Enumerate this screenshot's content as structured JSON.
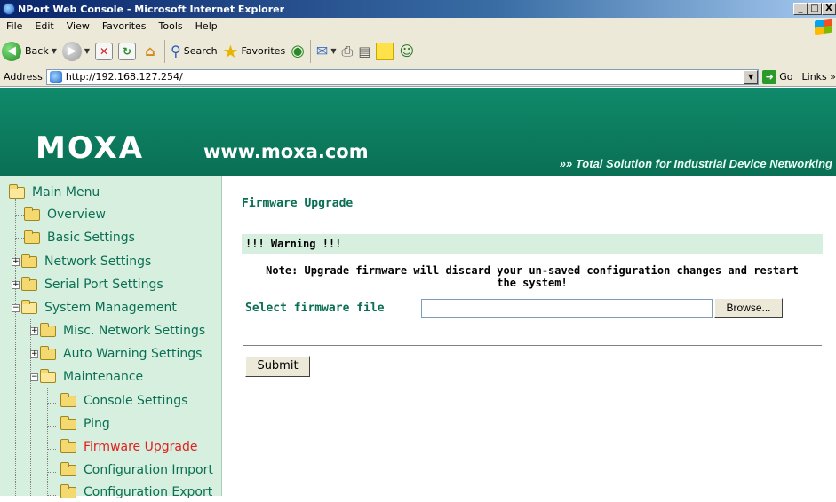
{
  "window": {
    "title": "NPort Web Console - Microsoft Internet Explorer",
    "buttons": [
      "_",
      "□",
      "X"
    ]
  },
  "menubar": [
    {
      "label": "File"
    },
    {
      "label": "Edit"
    },
    {
      "label": "View"
    },
    {
      "label": "Favorites"
    },
    {
      "label": "Tools"
    },
    {
      "label": "Help"
    }
  ],
  "toolbar": {
    "back_label": "Back",
    "search_label": "Search",
    "favorites_label": "Favorites"
  },
  "address": {
    "label": "Address",
    "url": "http://192.168.127.254/",
    "go_label": "Go",
    "links_label": "Links »"
  },
  "banner": {
    "logo": "MOXA",
    "site": "www.moxa.com",
    "tagline": "»» Total Solution for Industrial Device Networking"
  },
  "sidebar": {
    "items": [
      {
        "label": "Main Menu"
      },
      {
        "label": "Overview"
      },
      {
        "label": "Basic Settings"
      },
      {
        "label": "Network Settings"
      },
      {
        "label": "Serial Port Settings"
      },
      {
        "label": "System Management"
      },
      {
        "label": "Misc. Network Settings"
      },
      {
        "label": "Auto Warning Settings"
      },
      {
        "label": "Maintenance"
      },
      {
        "label": "Console Settings"
      },
      {
        "label": "Ping"
      },
      {
        "label": "Firmware Upgrade"
      },
      {
        "label": "Configuration Import"
      },
      {
        "label": "Configuration Export"
      }
    ],
    "active": "Firmware Upgrade"
  },
  "main": {
    "title": "Firmware Upgrade",
    "warning": "!!! Warning !!!",
    "note_line1": "Note: Upgrade firmware will discard your un-saved configuration changes and restart",
    "note_line2": "the system!",
    "file_label": "Select firmware file",
    "file_value": "",
    "browse_label": "Browse...",
    "submit_label": "Submit"
  },
  "colors": {
    "brand_green": "#0a6f55",
    "sidebar_bg": "#d7efdf",
    "active_item": "#e02020"
  },
  "icons": [
    "ie-logo-icon",
    "back-arrow-icon",
    "forward-arrow-icon",
    "stop-icon",
    "refresh-icon",
    "home-icon",
    "search-icon",
    "favorites-star-icon",
    "media-icon",
    "mail-icon",
    "print-icon",
    "edit-icon",
    "note-icon",
    "messenger-icon",
    "page-icon",
    "go-arrow-icon",
    "folder-icon",
    "windows-flag-icon"
  ]
}
